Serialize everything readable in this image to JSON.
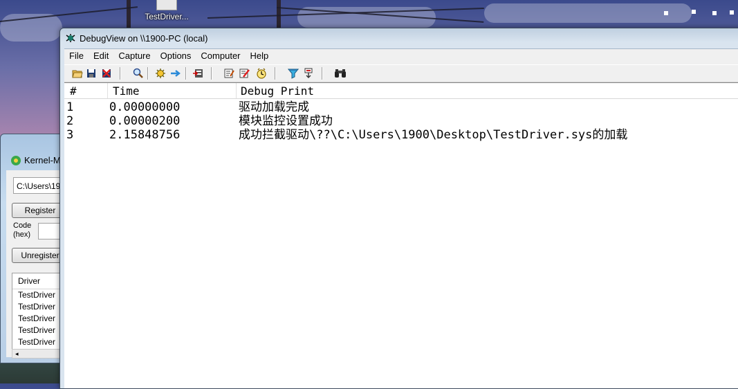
{
  "desktop": {
    "icon_label": "TestDriver..."
  },
  "kernel_window": {
    "title": "Kernel-M",
    "path_value": "C:\\Users\\19",
    "register_label": "Register",
    "code_label_line1": "Code",
    "code_label_line2": "(hex)",
    "unregister_label": "Unregister",
    "driver_header": "Driver",
    "drivers": [
      "TestDriver",
      "TestDriver",
      "TestDriver",
      "TestDriver",
      "TestDriver"
    ],
    "scroll_left": "◂"
  },
  "debugview": {
    "title": "DebugView on \\\\1900-PC (local)",
    "menu": [
      "File",
      "Edit",
      "Capture",
      "Options",
      "Computer",
      "Help"
    ],
    "columns": {
      "num": "#",
      "time": "Time",
      "debug": "Debug Print"
    },
    "rows": [
      {
        "num": "1",
        "time": "0.00000000",
        "text": "驱动加载完成"
      },
      {
        "num": "2",
        "time": "0.00000200",
        "text": "模块监控设置成功"
      },
      {
        "num": "3",
        "time": "2.15848756",
        "text": "成功拦截驱动\\??\\C:\\Users\\1900\\Desktop\\TestDriver.sys的加载"
      }
    ],
    "toolbar_icons": [
      "open-icon",
      "save-icon",
      "clear-icon",
      "find-icon",
      "capture-icon",
      "autoscroll-icon",
      "log-icon",
      "filter-icon",
      "highlight-icon",
      "clock-icon",
      "capture-kernel-icon",
      "capture-win32-icon",
      "search-binoculars-icon"
    ]
  }
}
